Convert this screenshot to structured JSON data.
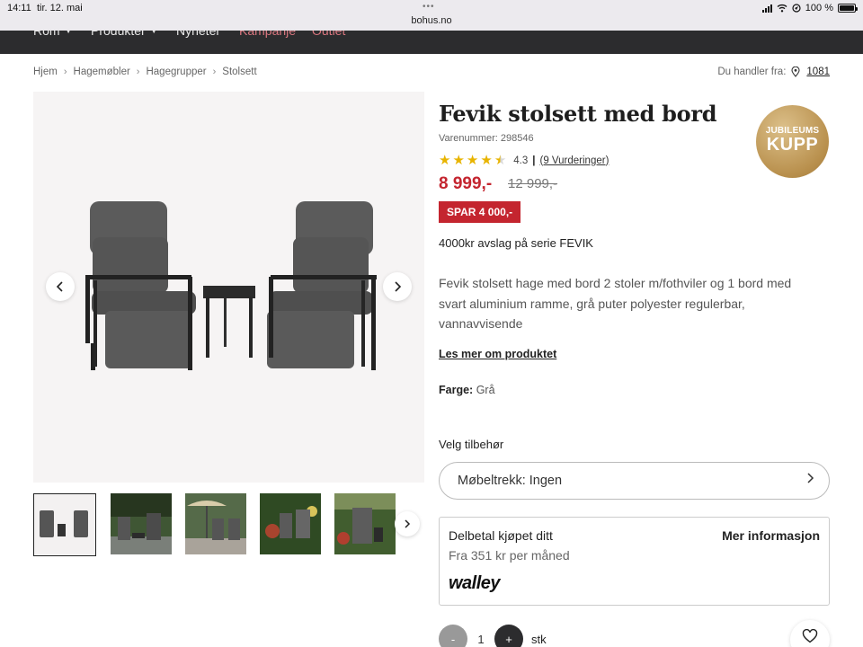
{
  "status_bar": {
    "time": "14:11",
    "date": "tir. 12. mai",
    "url": "bohus.no",
    "battery": "100 %"
  },
  "nav": {
    "items": [
      {
        "label": "Rom",
        "has_caret": true
      },
      {
        "label": "Produkter",
        "has_caret": true
      },
      {
        "label": "Nyheter",
        "has_caret": false
      },
      {
        "label": "Kampanje",
        "has_caret": false
      },
      {
        "label": "Outlet",
        "has_caret": false
      }
    ],
    "accent_color": "#d9767f"
  },
  "breadcrumb": [
    "Hjem",
    "Hagemøbler",
    "Hagegrupper",
    "Stolsett"
  ],
  "location": {
    "label": "Du handler fra:",
    "zip": "1081"
  },
  "product": {
    "title": "Fevik stolsett med bord",
    "sku": "Varenummer: 298546",
    "rating": 4.3,
    "rating_text": "4.3",
    "reviews_link": "(9 Vurderinger)",
    "price": "8 999,-",
    "old_price": "12 999,-",
    "save_badge": "SPAR 4 000,-",
    "discount_note": "4000kr avslag på serie FEVIK",
    "description": "Fevik stolsett hage med bord 2 stoler m/fothviler og 1 bord med svart aluminium ramme, grå puter polyester regulerbar, vannavvisende",
    "read_more": "Les mer om produktet",
    "color_label": "Farge:",
    "color_value": "Grå",
    "price_color": "#c4252f"
  },
  "badge": {
    "top": "JUBILEUMS",
    "main": "KUPP"
  },
  "accessories": {
    "label": "Velg tilbehør",
    "selected": "Møbeltrekk: Ingen"
  },
  "installment": {
    "title": "Delbetal kjøpet ditt",
    "more": "Mer informasjon",
    "subtitle": "Fra 351 kr per måned",
    "logo": "walley"
  },
  "quantity": {
    "minus": "-",
    "value": "1",
    "plus": "+",
    "unit": "stk"
  }
}
